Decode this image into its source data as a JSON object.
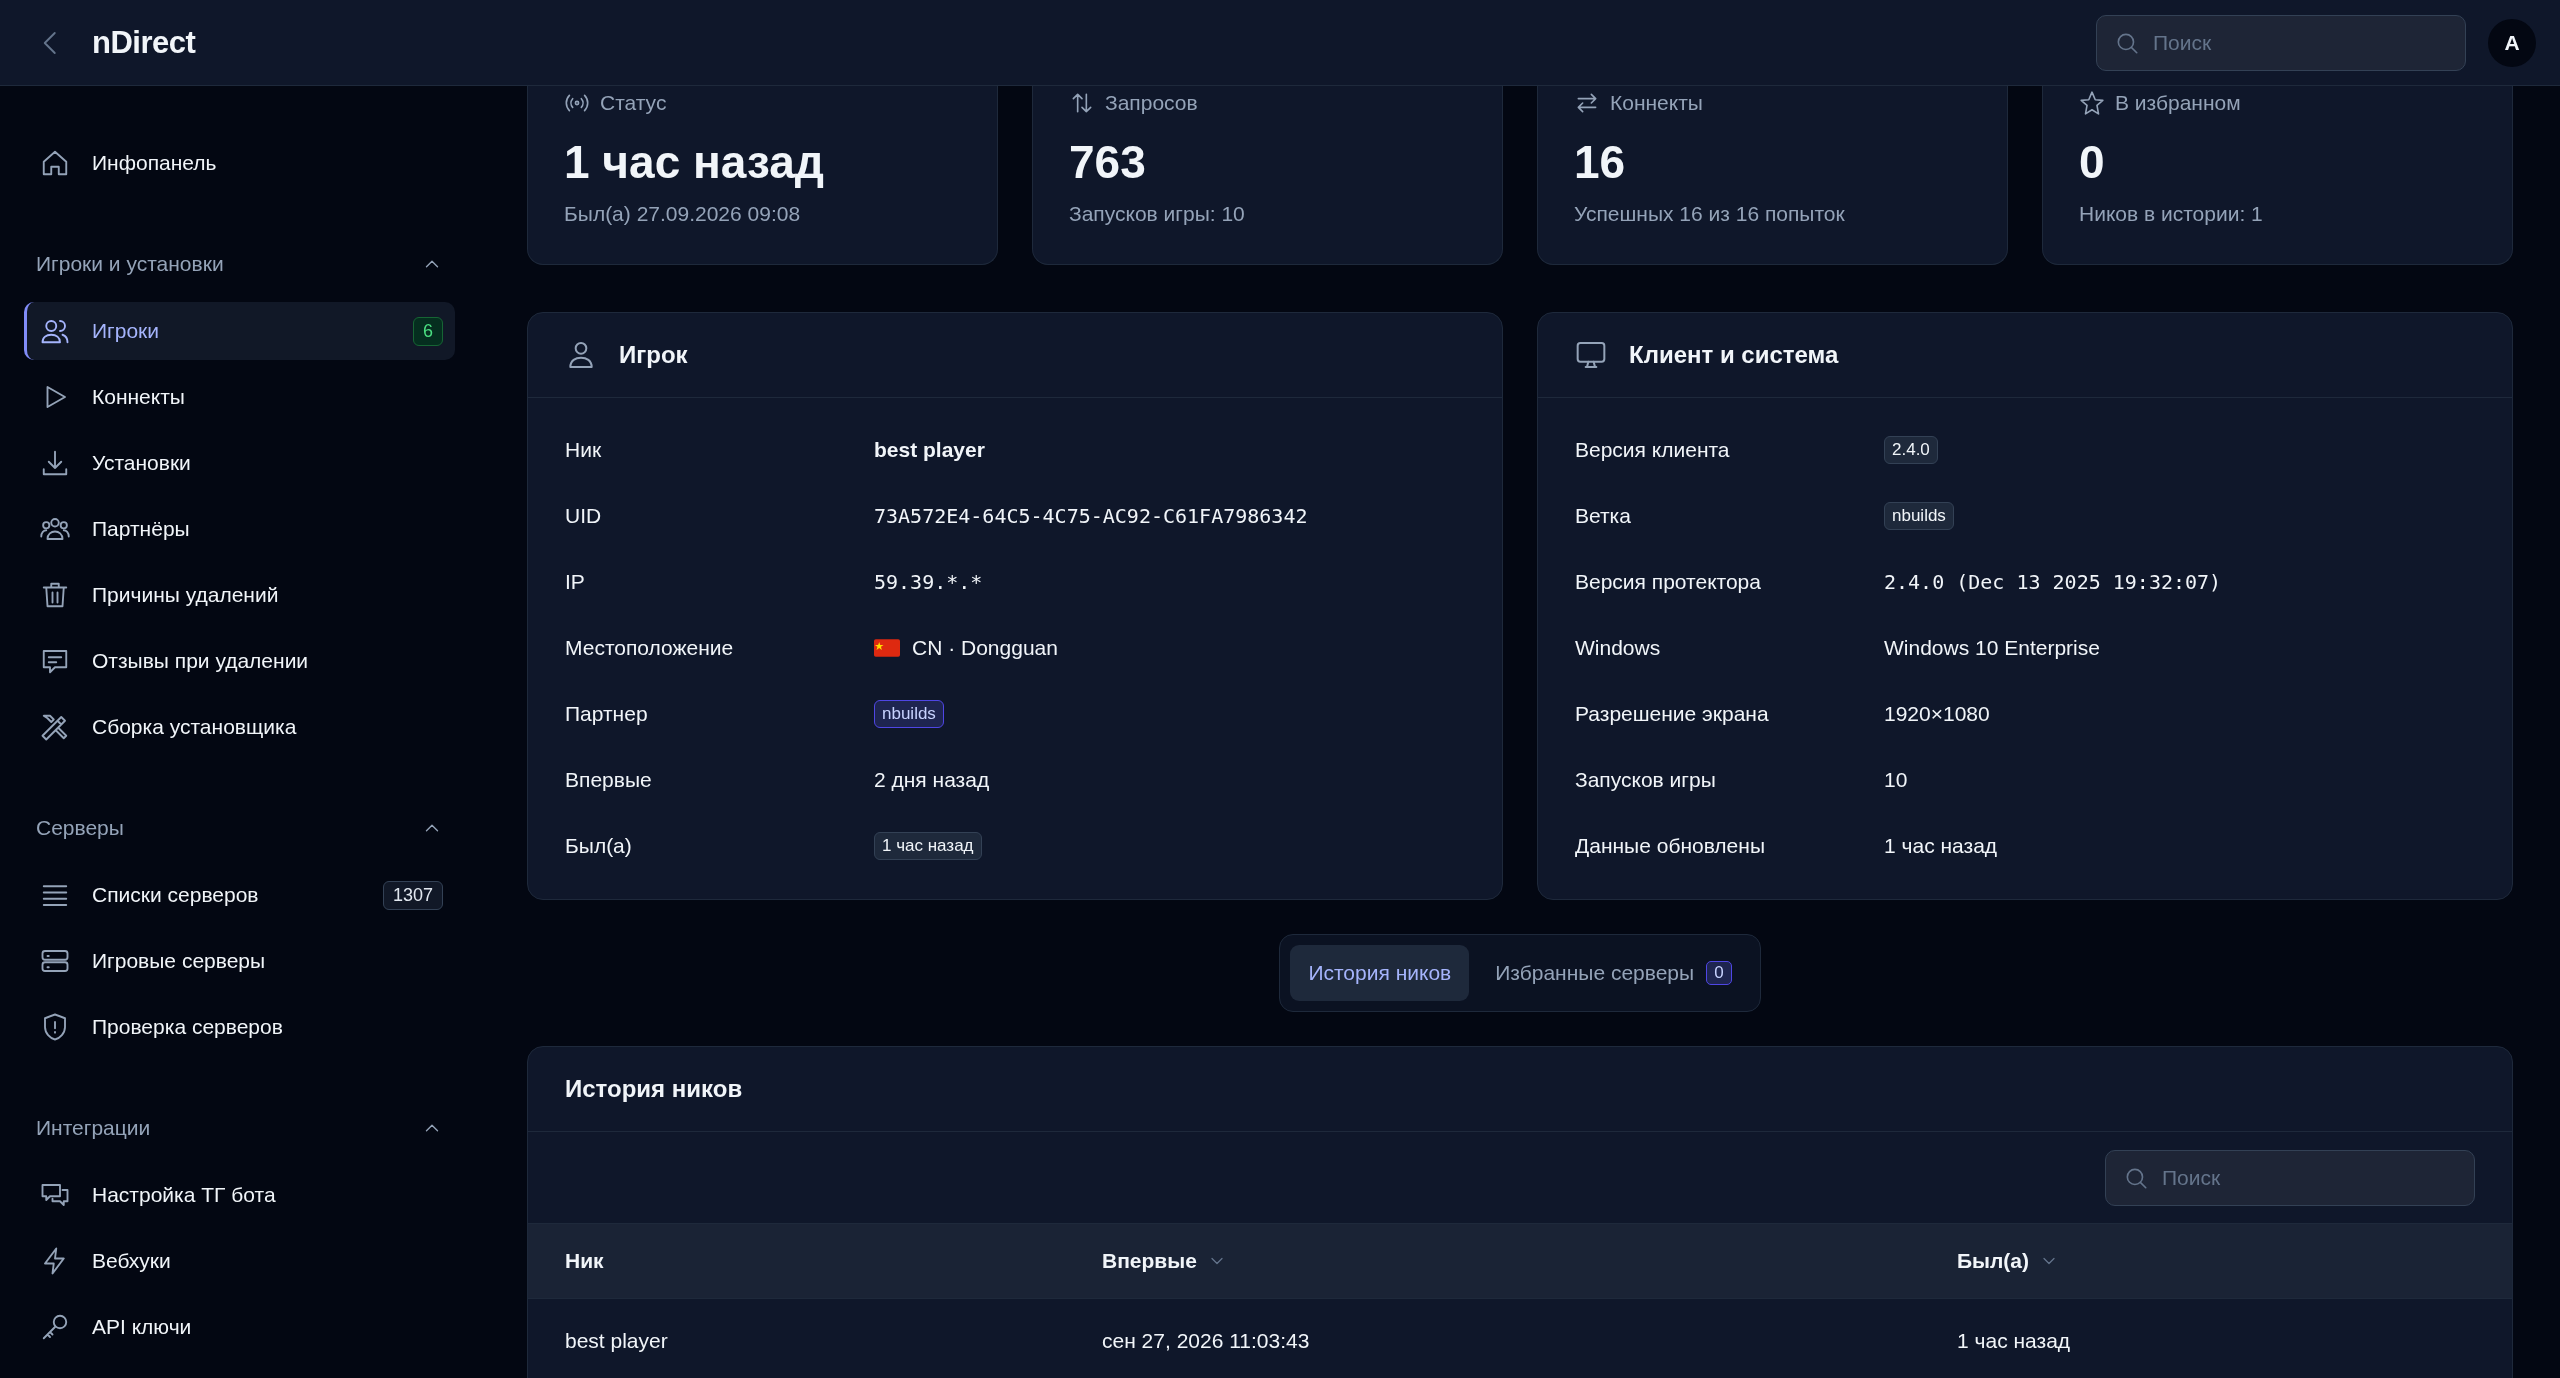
{
  "header": {
    "title": "nDirect",
    "search": {
      "placeholder": "Поиск"
    },
    "avatar": "A"
  },
  "sidebar": {
    "items": [
      {
        "label": "Инфопанель",
        "selected": false
      }
    ],
    "sections": [
      {
        "title": "Игроки и установки",
        "expanded": true,
        "items": [
          {
            "label": "Игроки",
            "selected": true,
            "badge": "6"
          },
          {
            "label": "Коннекты",
            "selected": false
          },
          {
            "label": "Установки",
            "selected": false
          },
          {
            "label": "Партнёры",
            "selected": false
          },
          {
            "label": "Причины удалений",
            "selected": false
          },
          {
            "label": "Отзывы при удалении",
            "selected": false
          },
          {
            "label": "Сборка установщика",
            "selected": false
          }
        ]
      },
      {
        "title": "Серверы",
        "expanded": true,
        "items": [
          {
            "label": "Списки серверов",
            "selected": false,
            "badge": "1307"
          },
          {
            "label": "Игровые серверы",
            "selected": false
          },
          {
            "label": "Проверка серверов",
            "selected": false
          }
        ]
      },
      {
        "title": "Интеграции",
        "expanded": true,
        "items": [
          {
            "label": "Настройка ТГ бота",
            "selected": false
          },
          {
            "label": "Вебхуки",
            "selected": false
          },
          {
            "label": "API ключи",
            "selected": false
          }
        ]
      }
    ]
  },
  "stats": [
    {
      "label": "Статус",
      "value": "1 час назад",
      "sub": "Был(а) 27.09.2026 09:08"
    },
    {
      "label": "Запросов",
      "value": "763",
      "sub": "Запусков игры: 10"
    },
    {
      "label": "Коннекты",
      "value": "16",
      "sub": "Успешных 16 из 16 попыток"
    },
    {
      "label": "В избранном",
      "value": "0",
      "sub": "Ников в истории: 1"
    }
  ],
  "panels": [
    {
      "title": "Игрок",
      "rows": [
        {
          "label": "Ник",
          "value": "best player",
          "kind": "bold"
        },
        {
          "label": "UID",
          "value": "73A572E4-64C5-4C75-AC92-C61FA7986342",
          "kind": "mono"
        },
        {
          "label": "IP",
          "value": "59.39.*.*",
          "kind": "mono"
        },
        {
          "label": "Местоположение",
          "value": "CN · Dongguan",
          "kind": "location"
        },
        {
          "label": "Партнер",
          "value": "nbuilds",
          "kind": "accent_tag"
        },
        {
          "label": "Впервые",
          "value": "2 дня назад",
          "kind": "text"
        },
        {
          "label": "Был(а)",
          "value": "1 час назад",
          "kind": "tag"
        }
      ]
    },
    {
      "title": "Клиент и система",
      "rows": [
        {
          "label": "Версия клиента",
          "value": "2.4.0",
          "kind": "tag"
        },
        {
          "label": "Ветка",
          "value": "nbuilds",
          "kind": "tag"
        },
        {
          "label": "Версия протектора",
          "value": "2.4.0 (Dec 13 2025 19:32:07)",
          "kind": "mono"
        },
        {
          "label": "Windows",
          "value": "Windows 10 Enterprise",
          "kind": "text"
        },
        {
          "label": "Разрешение экрана",
          "value": "1920×1080",
          "kind": "text"
        },
        {
          "label": "Запусков игры",
          "value": "10",
          "kind": "text"
        },
        {
          "label": "Данные обновлены",
          "value": "1 час назад",
          "kind": "text"
        }
      ]
    }
  ],
  "tabs": [
    {
      "label": "История ников",
      "selected": true
    },
    {
      "label": "Избранные серверы",
      "selected": false,
      "count": "0"
    }
  ],
  "table": {
    "title": "История ников",
    "search": {
      "placeholder": "Поиск"
    },
    "columns": [
      {
        "label": "Ник",
        "sortable": false
      },
      {
        "label": "Впервые",
        "sortable": true
      },
      {
        "label": "Был(а)",
        "sortable": true
      }
    ],
    "rows": [
      [
        "best player",
        "сен 27, 2026 11:03:43",
        "1 час назад"
      ]
    ]
  }
}
